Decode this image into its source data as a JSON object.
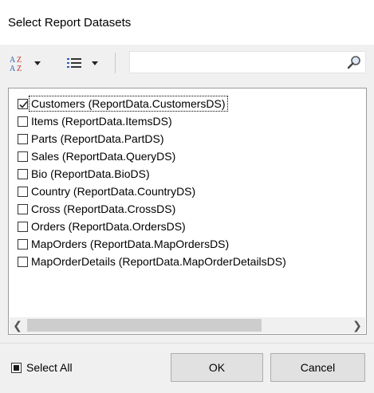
{
  "dialog": {
    "title": "Select Report Datasets"
  },
  "toolbar": {
    "sort_icon": "sort-az-icon",
    "view_icon": "list-view-icon",
    "search": {
      "value": "",
      "placeholder": ""
    }
  },
  "datasets": [
    {
      "label": "Customers  (ReportData.CustomersDS)",
      "checked": true,
      "focused": true
    },
    {
      "label": "Items  (ReportData.ItemsDS)",
      "checked": false
    },
    {
      "label": "Parts  (ReportData.PartDS)",
      "checked": false
    },
    {
      "label": "Sales  (ReportData.QueryDS)",
      "checked": false
    },
    {
      "label": "Bio  (ReportData.BioDS)",
      "checked": false
    },
    {
      "label": "Country  (ReportData.CountryDS)",
      "checked": false
    },
    {
      "label": "Cross  (ReportData.CrossDS)",
      "checked": false
    },
    {
      "label": "Orders  (ReportData.OrdersDS)",
      "checked": false
    },
    {
      "label": "MapOrders  (ReportData.MapOrdersDS)",
      "checked": false
    },
    {
      "label": "MapOrderDetails  (ReportData.MapOrderDetailsDS)",
      "checked": false
    }
  ],
  "footer": {
    "select_all_label": "Select All",
    "select_all_state": "indeterminate",
    "ok_label": "OK",
    "cancel_label": "Cancel"
  }
}
